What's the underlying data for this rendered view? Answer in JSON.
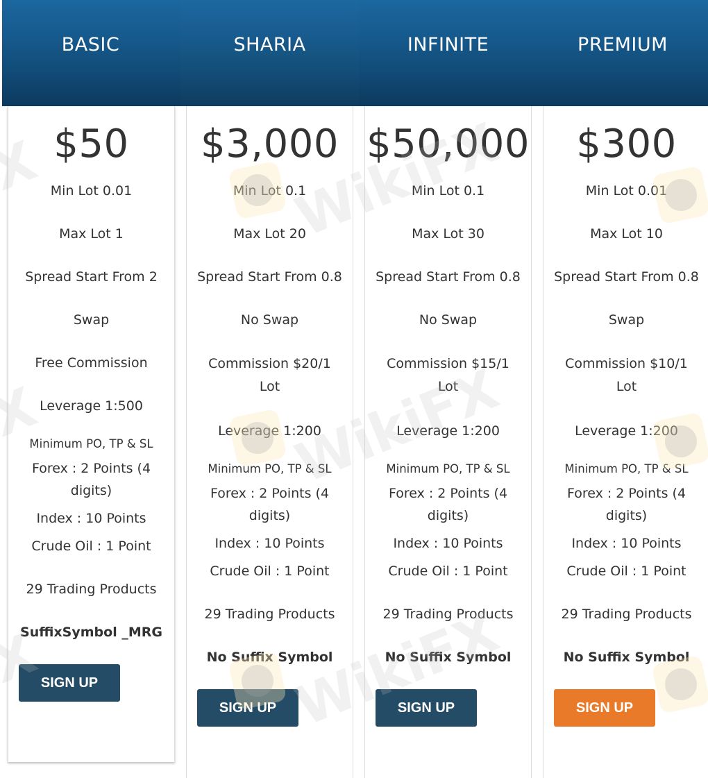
{
  "plans": [
    {
      "name": "BASIC",
      "price": "$50",
      "min_lot": "Min Lot 0.01",
      "max_lot": "Max Lot 1",
      "spread": "Spread Start From 2",
      "swap": "Swap",
      "commission": "Free Commission",
      "leverage": "Leverage 1:500",
      "min_title": "Minimum PO, TP & SL",
      "forex": "Forex : 2 Points (4 digits)",
      "index": "Index : 10 Points",
      "crude": "Crude Oil : 1 Point",
      "products": "29 Trading Products",
      "suffix": "SuffixSymbol _MRG",
      "button": "SIGN UP",
      "button_color": "#254c66"
    },
    {
      "name": "SHARIA",
      "price": "$3,000",
      "min_lot": "Min Lot 0.1",
      "max_lot": "Max Lot 20",
      "spread": "Spread Start From 0.8",
      "swap": "No Swap",
      "commission": "Commission $20/1 Lot",
      "leverage": "Leverage 1:200",
      "min_title": "Minimum PO, TP & SL",
      "forex": "Forex : 2 Points (4 digits)",
      "index": "Index : 10 Points",
      "crude": "Crude Oil : 1 Point",
      "products": "29 Trading Products",
      "suffix": "No Suffix Symbol",
      "button": "SIGN UP",
      "button_color": "#254c66"
    },
    {
      "name": "INFINITE",
      "price": "$50,000",
      "min_lot": "Min Lot 0.1",
      "max_lot": "Max Lot 30",
      "spread": "Spread Start From 0.8",
      "swap": "No Swap",
      "commission": "Commission $15/1 Lot",
      "leverage": "Leverage 1:200",
      "min_title": "Minimum PO, TP & SL",
      "forex": "Forex : 2 Points (4 digits)",
      "index": "Index : 10 Points",
      "crude": "Crude Oil : 1 Point",
      "products": "29 Trading Products",
      "suffix": "No Suffix Symbol",
      "button": "SIGN UP",
      "button_color": "#254c66"
    },
    {
      "name": "PREMIUM",
      "price": "$300",
      "min_lot": "Min Lot 0.01",
      "max_lot": "Max Lot 10",
      "spread": "Spread Start From 0.8",
      "swap": "Swap",
      "commission": "Commission $10/1 Lot",
      "leverage": "Leverage 1:200",
      "min_title": "Minimum PO, TP & SL",
      "forex": "Forex : 2 Points (4 digits)",
      "index": "Index : 10 Points",
      "crude": "Crude Oil : 1 Point",
      "products": "29 Trading Products",
      "suffix": "No Suffix Symbol",
      "button": "SIGN UP",
      "button_color": "#e87a2a"
    }
  ],
  "watermark": {
    "text": "WikiFX"
  }
}
